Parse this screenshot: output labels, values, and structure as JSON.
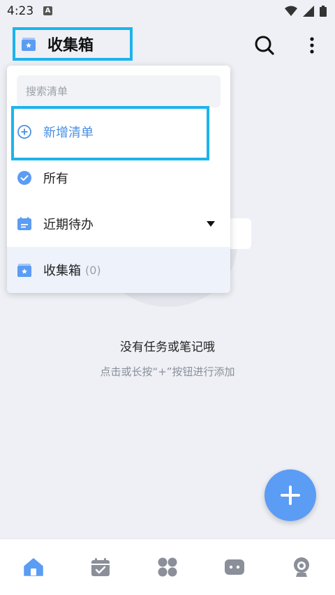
{
  "status_bar": {
    "time": "4:23",
    "notification_letter": "A"
  },
  "header": {
    "title": "收集箱"
  },
  "dropdown": {
    "search_placeholder": "搜索清单",
    "add_list_label": "新增清单",
    "items": [
      {
        "label": "所有",
        "icon": "check-circle-icon"
      },
      {
        "label": "近期待办",
        "icon": "calendar-list-icon",
        "has_caret": true
      },
      {
        "label": "收集箱",
        "count": "(0)",
        "icon": "inbox-star-icon",
        "selected": true
      }
    ]
  },
  "empty_state": {
    "title": "没有任务或笔记哦",
    "hint": "点击或长按“+”按钮进行添加"
  },
  "bottom_nav": [
    "home-icon",
    "calendar-check-icon",
    "apps-grid-icon",
    "chat-bubble-icon",
    "profile-icon"
  ],
  "colors": {
    "accent": "#5b9cf4",
    "highlight_border": "#1cb4ec",
    "background": "#eef0f5"
  }
}
